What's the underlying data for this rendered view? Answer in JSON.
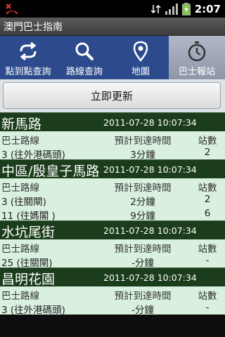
{
  "status_bar": {
    "time": "2:07",
    "icons": [
      "missed-call-icon",
      "signal-icon",
      "battery-icon"
    ]
  },
  "app": {
    "title": "澳門巴士指南"
  },
  "tabs": [
    {
      "label": "點到點查詢",
      "icon": "swap-arrows-icon"
    },
    {
      "label": "路線查詢",
      "icon": "search-icon"
    },
    {
      "label": "地圖",
      "icon": "map-pin-icon"
    },
    {
      "label": "巴士報站",
      "icon": "stopwatch-icon",
      "active": true
    }
  ],
  "refresh_label": "立即更新",
  "columns": {
    "route": "巴士路線",
    "eta": "預計到達時間",
    "stops": "站數"
  },
  "stations": [
    {
      "name": "新馬路",
      "time": "2011-07-28 10:07:34",
      "rows": [
        {
          "route": "3 (往外港碼頭)",
          "eta": "3分鐘",
          "stops": "2"
        }
      ]
    },
    {
      "name": "中區/殷皇子馬路",
      "time": "2011-07-28 10:07:34",
      "rows": [
        {
          "route": "3 (往關閘)",
          "eta": "2分鐘",
          "stops": "2"
        },
        {
          "route": "11 (往媽閣 )",
          "eta": "9分鐘",
          "stops": "6"
        }
      ]
    },
    {
      "name": "水坑尾街",
      "time": "2011-07-28 10:07:34",
      "rows": [
        {
          "route": "25 (往關閘)",
          "eta": "-分鐘",
          "stops": "-"
        }
      ]
    },
    {
      "name": "昌明花園",
      "time": "2011-07-28 10:07:34",
      "rows": [
        {
          "route": "3 (往外港碼頭)",
          "eta": "-分鐘",
          "stops": "-"
        }
      ]
    }
  ],
  "colors": {
    "tab_bar": "#2c4a8c",
    "section_header": "#1b3d1b",
    "row_bg": "#d9f0df",
    "battery": "#7fc241"
  }
}
